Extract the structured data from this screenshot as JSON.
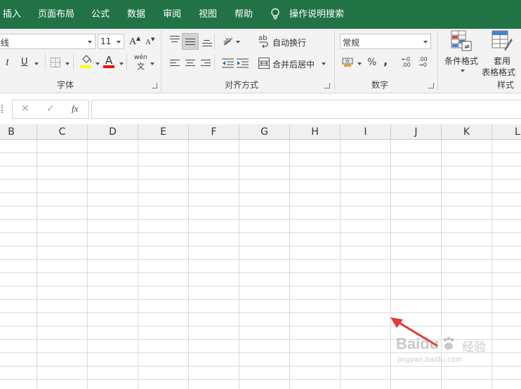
{
  "tabs": [
    "插入",
    "页面布局",
    "公式",
    "数据",
    "审阅",
    "视图",
    "帮助"
  ],
  "tell_me": "操作说明搜索",
  "font_group": {
    "font_name": "线",
    "font_size": "11",
    "grow_label": "A",
    "shrink_label": "A",
    "italic_label": "I",
    "underline_label": "U",
    "font_color_label": "A",
    "phonetic_top": "wén",
    "phonetic_bottom": "文",
    "group_label": "字体",
    "fill_color": "#ffff00",
    "font_color": "#ff0000"
  },
  "align_group": {
    "wrap_text": "自动换行",
    "merge_center": "合并后居中",
    "wrap_icon_text": "ab",
    "group_label": "对齐方式"
  },
  "number_group": {
    "format": "常规",
    "percent": "%",
    "comma": ",",
    "inc_decimal_top": "←0",
    "inc_decimal_bottom": ".00",
    "dec_decimal_top": ".00",
    "dec_decimal_bottom": "→0",
    "group_label": "数字"
  },
  "styles_group": {
    "conditional_format": "条件格式",
    "table_format_line1": "套用",
    "table_format_line2": "表格格式",
    "group_label": "样式"
  },
  "formula_bar": {
    "cancel": "✕",
    "enter": "✓",
    "fx": "fx",
    "value": ""
  },
  "columns": [
    "B",
    "C",
    "D",
    "E",
    "F",
    "G",
    "H",
    "I",
    "J",
    "K",
    "L"
  ],
  "watermark": {
    "brand": "Baidu",
    "brand_cn": "经验",
    "url": "jingyan.baidu.com"
  },
  "colors": {
    "ribbon_green": "#217346",
    "arrow_red": "#e53935"
  }
}
